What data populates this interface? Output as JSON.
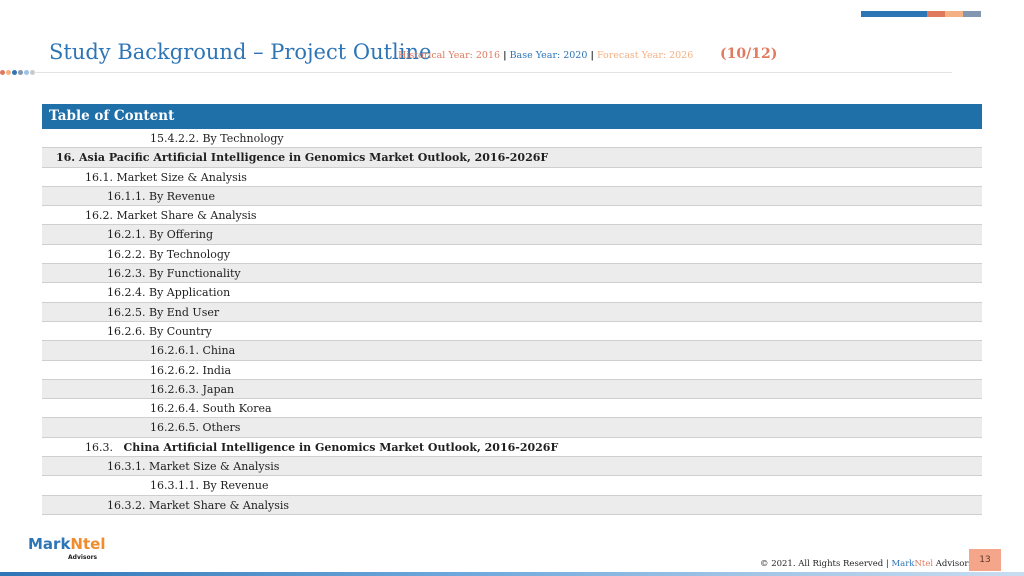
{
  "header": {
    "title": "Study Background – Project Outline",
    "historical": "Historical Year: 2016",
    "base": "Base Year: 2020",
    "forecast": "Forecast Year: 2026",
    "separator": "|",
    "page_indicator": "(10/12)"
  },
  "colors": {
    "accent_blue": "#2e75b6",
    "header_blue": "#1f6fa9",
    "accent_salmon": "#e07a5f",
    "accent_peach": "#f4b183",
    "accent_gray": "#8497b0"
  },
  "toc": {
    "header": "Table of Content",
    "rows": [
      {
        "text": "15.4.2.2. By Technology"
      },
      {
        "text": "16.  Asia Pacific Artificial Intelligence in Genomics Market Outlook, 2016-2026F"
      },
      {
        "text": "16.1.   Market Size & Analysis"
      },
      {
        "text": "16.1.1.   By Revenue"
      },
      {
        "text": "16.2.   Market Share & Analysis"
      },
      {
        "text": "16.2.1.   By Offering"
      },
      {
        "text": "16.2.2.   By Technology"
      },
      {
        "text": "16.2.3.   By Functionality"
      },
      {
        "text": "16.2.4.   By Application"
      },
      {
        "text": "16.2.5.   By End User"
      },
      {
        "text": "16.2.6.   By Country"
      },
      {
        "text": "16.2.6.1. China"
      },
      {
        "text": "16.2.6.2. India"
      },
      {
        "text": "16.2.6.3. Japan"
      },
      {
        "text": "16.2.6.4. South Korea"
      },
      {
        "text": "16.2.6.5. Others"
      },
      {
        "num": "16.3.",
        "text": "China Artificial Intelligence in Genomics Market Outlook, 2016-2026F"
      },
      {
        "text": "16.3.1.   Market Size & Analysis"
      },
      {
        "text": "16.3.1.1. By Revenue"
      },
      {
        "text": "16.3.2.   Market Share & Analysis"
      }
    ]
  },
  "logo": {
    "part1": "Mark",
    "part2": "Ntel",
    "sub": "Advisors"
  },
  "footer": {
    "copyright": "© 2021. All Rights Reserved |",
    "mark": "Mark",
    "ntel": "Ntel",
    "advisors": "Advisors",
    "page_number": "13"
  }
}
